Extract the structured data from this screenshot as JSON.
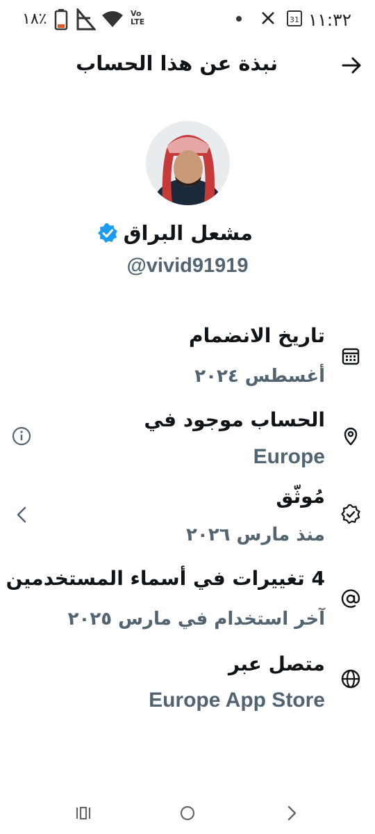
{
  "status": {
    "time": "١١:٣٢",
    "battery": "٪١٨"
  },
  "header": {
    "title": "نبذة عن هذا الحساب"
  },
  "profile": {
    "name": "مشعل البراق",
    "handle": "@vivid91919"
  },
  "rows": [
    {
      "title": "تاريخ الانضمام",
      "value": "أغسطس ٢٠٢٤",
      "icon": "calendar-icon"
    },
    {
      "title": "الحساب موجود في",
      "value": "Europe",
      "icon": "location-pin-icon"
    },
    {
      "title": "مُوثّق",
      "value": "منذ مارس ٢٠٢٦",
      "icon": "verified-badge-icon"
    },
    {
      "title": "4 تغييرات في أسماء المستخدمين",
      "value": "آخر استخدام في مارس ٢٠٢٥",
      "icon": "at-sign-icon"
    },
    {
      "title": "متصل عبر",
      "value": "Europe App Store",
      "icon": "globe-icon"
    }
  ],
  "colors": {
    "accent": "#1d9bf0",
    "text": "#0f1419",
    "secondary": "#536471"
  }
}
